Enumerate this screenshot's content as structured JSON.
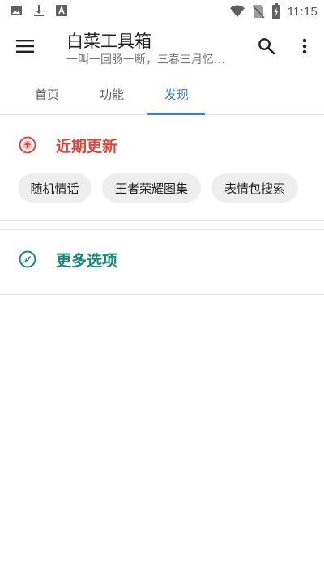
{
  "status_bar": {
    "time": "11:15",
    "left_icons": [
      "image-icon",
      "download-icon",
      "font-icon"
    ],
    "right_icons": [
      "wifi-icon",
      "no-sim-icon",
      "battery-charging-icon"
    ]
  },
  "app_bar": {
    "title": "白菜工具箱",
    "subtitle": "一叫一回肠一断，三春三月忆…",
    "icons": [
      "menu-icon",
      "search-icon",
      "more-vert-icon"
    ]
  },
  "tabs": [
    {
      "label": "首页",
      "selected": false
    },
    {
      "label": "功能",
      "selected": false
    },
    {
      "label": "发现",
      "selected": true
    }
  ],
  "sections": {
    "recent": {
      "title": "近期更新",
      "icon": "arrow-up-circle-icon",
      "color": "#e0453a",
      "chips": [
        "随机情话",
        "王者荣耀图集",
        "表情包搜索"
      ]
    },
    "more": {
      "title": "更多选项",
      "icon": "compass-icon",
      "color": "#16897c"
    }
  },
  "colors": {
    "accent": "#3a7bd5",
    "chip_bg": "#eeeeee",
    "divider": "#e6e6e6"
  }
}
